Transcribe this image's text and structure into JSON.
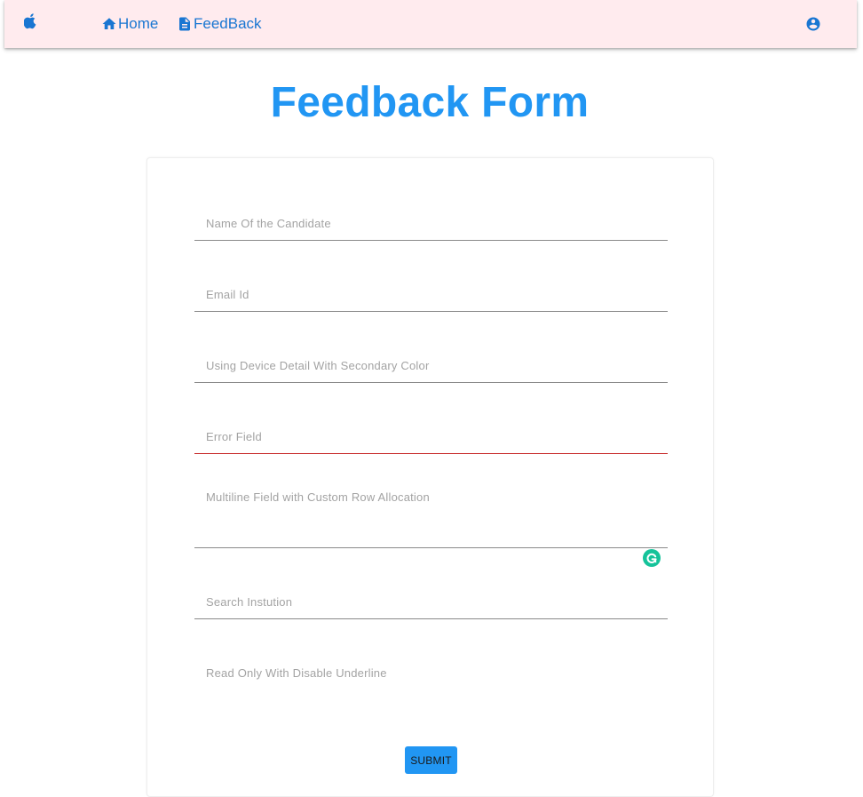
{
  "navbar": {
    "logo_icon": "apple-icon",
    "background": "#ffebee",
    "links": [
      {
        "label": "Home",
        "icon": "home-icon"
      },
      {
        "label": "FeedBack",
        "icon": "document-icon"
      }
    ],
    "account_icon": "account-circle-icon",
    "link_color": "#1976d2"
  },
  "page": {
    "title": "Feedback Form",
    "title_color": "#2196f3"
  },
  "form": {
    "fields": [
      {
        "label": "Name Of the Candidate",
        "state": "normal"
      },
      {
        "label": "Email Id",
        "state": "normal"
      },
      {
        "label": "Using Device Detail With Secondary Color",
        "state": "normal"
      },
      {
        "label": "Error Field",
        "state": "error"
      },
      {
        "label": "Multiline Field with Custom Row Allocation",
        "state": "normal"
      },
      {
        "label": "Search Instution",
        "state": "normal"
      },
      {
        "label": "Read Only With Disable Underline",
        "state": "read-only"
      }
    ],
    "error_color": "#c62828",
    "submit_label": "SUBMIT",
    "submit_color": "#2196f3"
  },
  "overlay": {
    "grammarly_icon": "grammarly-icon",
    "grammarly_color": "#15c39a"
  }
}
